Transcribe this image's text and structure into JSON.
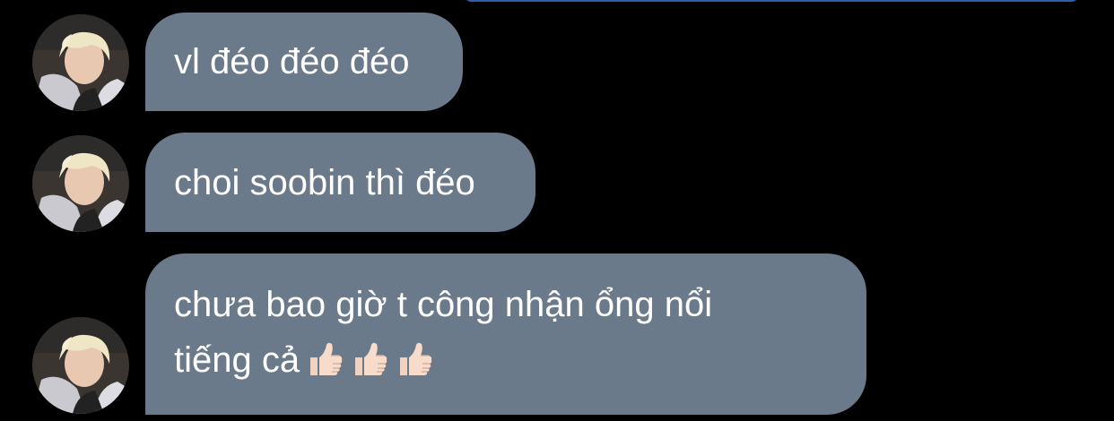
{
  "conversation": {
    "messages": [
      {
        "text": "vl đéo đéo đéo"
      },
      {
        "text": "choi soobin thì đéo"
      },
      {
        "line1": "chưa bao giờ t công nhận ổng nổi",
        "line2": "tiếng cả",
        "emojis": [
          "thumbs-up",
          "thumbs-up",
          "thumbs-up"
        ]
      }
    ]
  },
  "colors": {
    "background": "#000000",
    "bubble": "#6a7a8a",
    "text": "#ffffff",
    "accent_edge": "#2f5fa8"
  }
}
